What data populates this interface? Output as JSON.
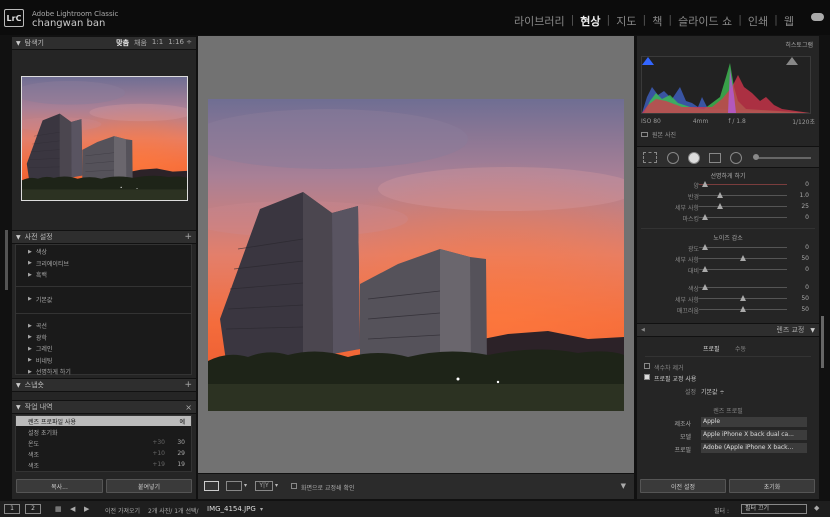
{
  "app": {
    "logo": "LrC",
    "name": "Adobe Lightroom Classic",
    "user": "changwan ban"
  },
  "modules": [
    {
      "label": "라이브러리"
    },
    {
      "label": "현상"
    },
    {
      "label": "지도"
    },
    {
      "label": "책"
    },
    {
      "label": "슬라이드 쇼"
    },
    {
      "label": "인쇄"
    },
    {
      "label": "웹"
    }
  ],
  "active_module": "현상",
  "left": {
    "navigator": {
      "title": "탐색기",
      "opt_fit": "맞춤",
      "opt_fill": "채움",
      "opt_1_1": "1:1",
      "opt_ratio": "1:16 ÷"
    },
    "presets": {
      "title": "사전 설정",
      "add": "+",
      "groups_a": [
        "색상",
        "크리에이티브",
        "흑백"
      ],
      "groups_b": [
        "기본값"
      ],
      "groups_c": [
        "곡선",
        "광학",
        "그레인",
        "비네팅",
        "선명하게 하기"
      ]
    },
    "snapshots": {
      "title": "스냅숏",
      "add": "+"
    },
    "history": {
      "title": "작업 내역",
      "close": "×",
      "rows": [
        {
          "label": "렌즈 프로파일 사용",
          "delta": "",
          "value": "예"
        },
        {
          "label": "설정 초기화",
          "delta": "",
          "value": ""
        },
        {
          "label": "온도",
          "delta": "+30",
          "value": "30"
        },
        {
          "label": "색조",
          "delta": "+10",
          "value": "29"
        },
        {
          "label": "색조",
          "delta": "+19",
          "value": "19"
        }
      ]
    },
    "copy_button": "복사...",
    "paste_button": "붙여넣기"
  },
  "right": {
    "histogram": {
      "title": "히스토그램",
      "iso": "ISO 80",
      "focal": "4mm",
      "aperture": "f / 1.8",
      "shutter": "1/120초",
      "original": "원본 사진"
    },
    "sharpen": {
      "title": "선명하게 하기",
      "rows": [
        {
          "label": "양",
          "value": "0",
          "pos": 0.05
        },
        {
          "label": "반경",
          "value": "1.0",
          "pos": 0.25
        },
        {
          "label": "세부 사항",
          "value": "25",
          "pos": 0.25
        },
        {
          "label": "마스킹",
          "value": "0",
          "pos": 0.05
        }
      ]
    },
    "noise": {
      "title": "노이즈 감소",
      "rows": [
        {
          "label": "광도",
          "value": "0",
          "pos": 0.05
        },
        {
          "label": "세부 사항",
          "value": "50",
          "pos": 0.5
        },
        {
          "label": "대비",
          "value": "0",
          "pos": 0.05
        },
        {
          "label": "색상",
          "value": "0",
          "pos": 0.05
        },
        {
          "label": "세부 사항",
          "value": "50",
          "pos": 0.5
        },
        {
          "label": "매끄러움",
          "value": "50",
          "pos": 0.5
        }
      ]
    },
    "lens": {
      "title": "렌즈 교정",
      "tab_profile": "프로필",
      "tab_manual": "수동",
      "chk_ca": "색수차 제거",
      "chk_profile": "프로필 교정 사용",
      "setting_label": "설정",
      "setting_value": "기본값 ÷",
      "lens_profile_title": "렌즈 프로필",
      "make_label": "제조사",
      "make_value": "Apple",
      "model_label": "모델",
      "model_value": "Apple iPhone X back dual ca...",
      "profile_label": "프로필",
      "profile_value": "Adobe (Apple iPhone X back..."
    },
    "prev_button": "이전 설정",
    "reset_button": "초기화"
  },
  "toolbar": {
    "yy_label": "Y|Y",
    "softproof": "화면으로 교정쇄 확인"
  },
  "filmstrip": {
    "screen1": "1",
    "screen2": "2",
    "source": "이전 가져오기",
    "count": "2개 사진/ 1개 선택/",
    "filename": "IMG_4154.JPG",
    "filter_label": "필터 :",
    "filter_value": "필터 끄기"
  }
}
